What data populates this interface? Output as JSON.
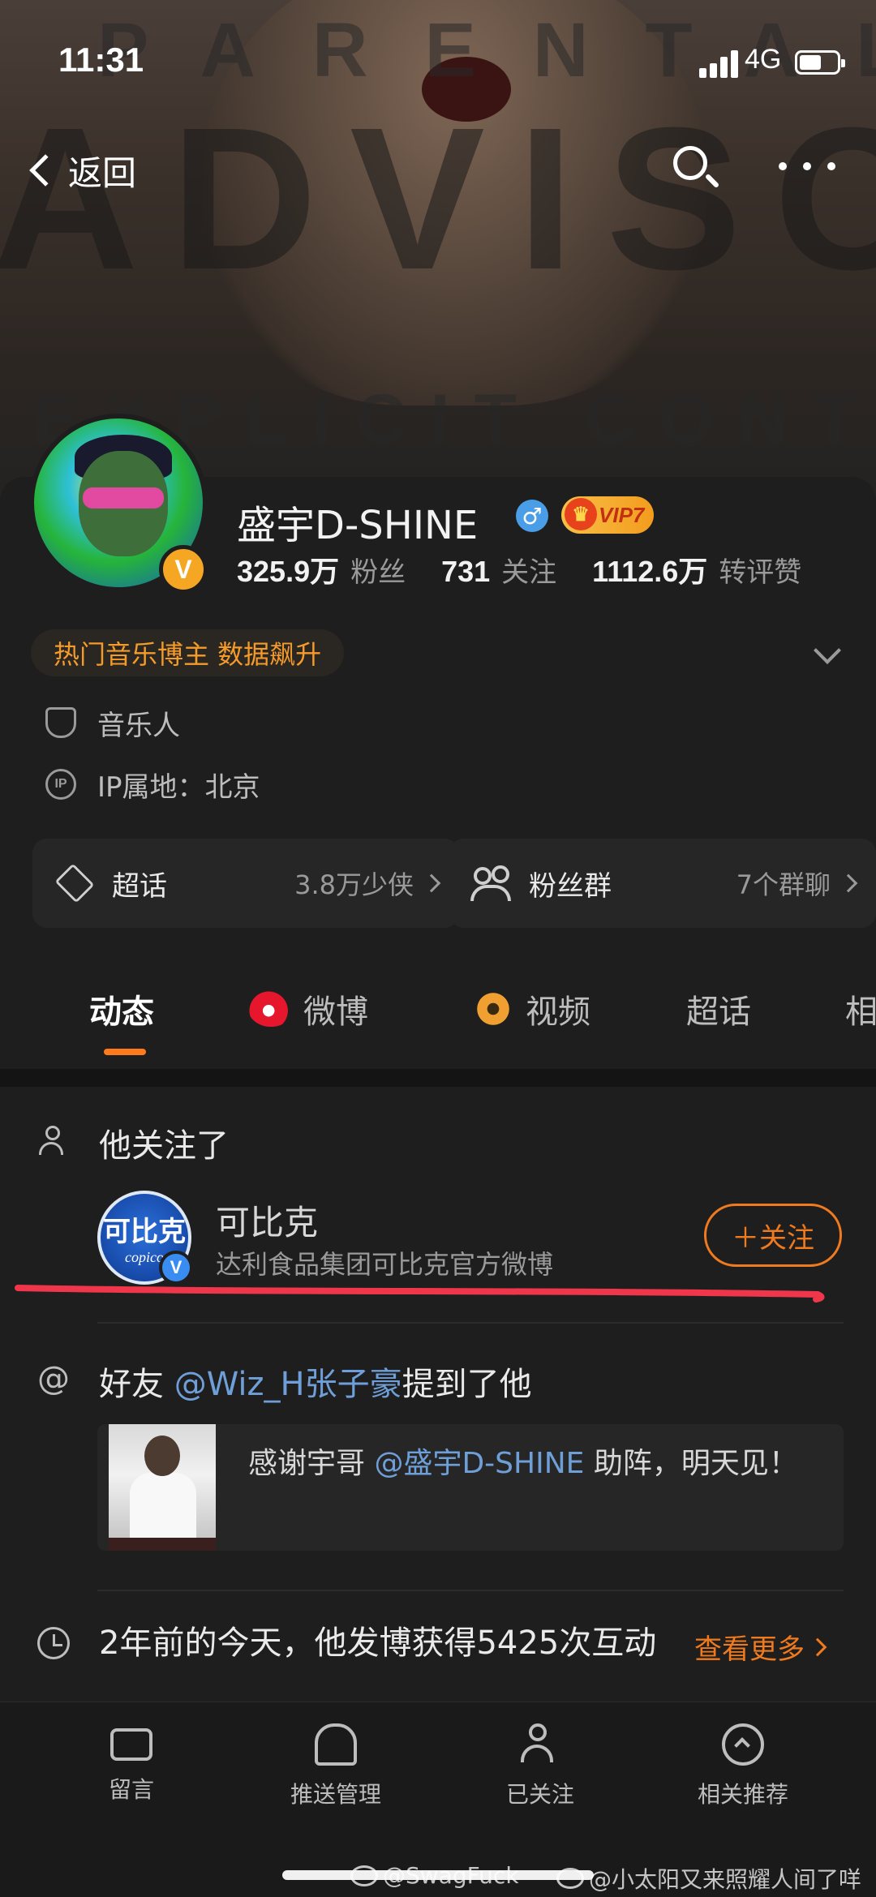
{
  "status_bar": {
    "time": "11:31",
    "network": "4G"
  },
  "nav": {
    "back_label": "返回"
  },
  "banner": {
    "top_text": "PARENTAL",
    "big_text": "ADVISORY",
    "bottom_text": "EXPLICIT CONTENT"
  },
  "profile": {
    "name": "盛宇D-SHINE",
    "gender_symbol": "♂",
    "vip_label": "VIP7",
    "verified_badge": "V",
    "stats": [
      {
        "value": "325.9万",
        "label": "粉丝"
      },
      {
        "value": "731",
        "label": "关注"
      },
      {
        "value": "1112.6万",
        "label": "转评赞"
      }
    ],
    "hot_tag": "热门音乐博主 数据飙升",
    "info": [
      {
        "icon": "shield-icon",
        "text": "音乐人"
      },
      {
        "icon": "ip-icon",
        "icon_text": "IP",
        "text": "IP属地：北京"
      }
    ],
    "quick_links": [
      {
        "icon": "diamond-icon",
        "label": "超话",
        "value": "3.8万少侠"
      },
      {
        "icon": "fans-group-icon",
        "label": "粉丝群",
        "value": "7个群聊"
      }
    ]
  },
  "tabs": [
    {
      "label": "动态",
      "active": true
    },
    {
      "label": "微博",
      "icon": "weibo-icon"
    },
    {
      "label": "视频",
      "icon": "video-icon"
    },
    {
      "label": "超话"
    },
    {
      "label": "相"
    }
  ],
  "feed": {
    "followed_section": {
      "title": "他关注了",
      "account": {
        "name": "可比克",
        "description": "达利食品集团可比克官方微博",
        "logo_text_cn": "可比克",
        "logo_text_en": "copico",
        "follow_label": "＋关注"
      }
    },
    "mention_section": {
      "prefix": "好友 ",
      "mention_user": "@Wiz_H张子豪",
      "suffix": "提到了他",
      "quote_prefix": "感谢宇哥 ",
      "quote_mention": "@盛宇D-SHINE",
      "quote_suffix": " 助阵，明天见！"
    },
    "memory_section": {
      "text": "2年前的今天，他发博获得5425次互动",
      "see_more": "查看更多"
    }
  },
  "bottom_bar": [
    {
      "icon": "message-icon",
      "label": "留言"
    },
    {
      "icon": "bell-icon",
      "label": "推送管理"
    },
    {
      "icon": "followed-icon",
      "label": "已关注"
    },
    {
      "icon": "recommend-icon",
      "label": "相关推荐"
    }
  ],
  "watermarks": [
    "@SwagFuck",
    "@小太阳又来照耀人间了咩"
  ],
  "colors": {
    "accent": "#f07a1e",
    "link": "#6f9fd8",
    "background": "#1e1e1e",
    "annotation_red": "#f0364a"
  }
}
